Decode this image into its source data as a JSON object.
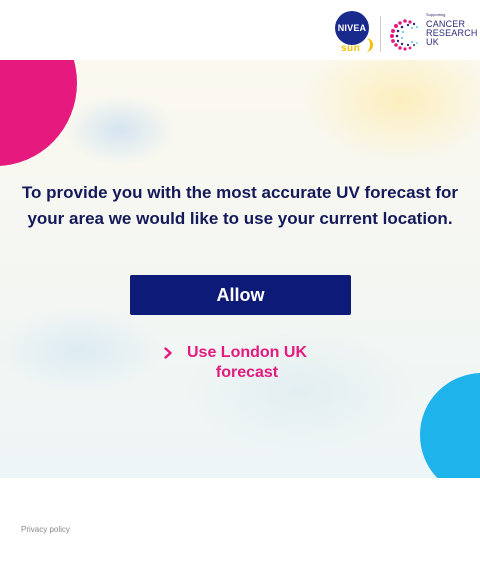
{
  "header": {
    "nivea_logo_text": "NIVEA",
    "sun_text": "sun",
    "supporting_text": "Supporting",
    "cruk_lines": [
      "CANCER",
      "RESEARCH",
      "UK"
    ]
  },
  "main": {
    "message": "To provide you with the most accurate UV forecast for your area we would like to use your current location.",
    "allow_button_label": "Allow",
    "london_link_label": "Use London UK forecast"
  },
  "footer": {
    "privacy_label": "Privacy policy"
  },
  "colors": {
    "navy": "#0e1a78",
    "pink": "#e5197e",
    "blue": "#1eb3ea",
    "text": "#14195a"
  },
  "icons": {
    "chevron": "chevron-right-icon"
  }
}
